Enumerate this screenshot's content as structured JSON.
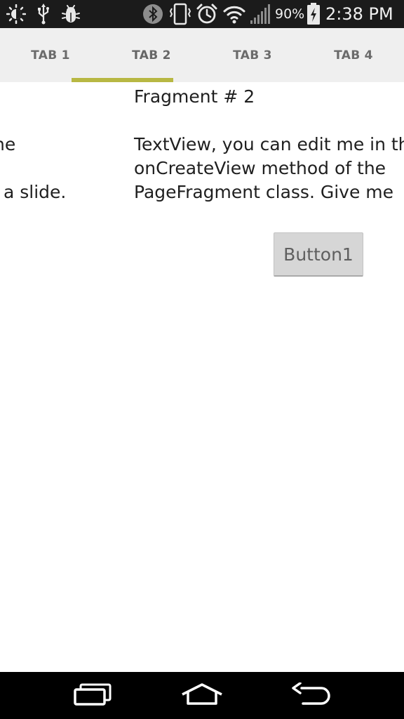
{
  "status_bar": {
    "battery_percent": "90%",
    "time": "2:38 PM",
    "icons": [
      "brightness-icon",
      "usb-icon",
      "debug-icon",
      "bluetooth-icon",
      "vibrate-icon",
      "alarm-icon",
      "wifi-icon",
      "signal-icon",
      "battery-charging-icon"
    ]
  },
  "tabs": [
    {
      "label": "TAB 1"
    },
    {
      "label": "TAB 2"
    },
    {
      "label": "TAB 3"
    },
    {
      "label": "TAB 4"
    }
  ],
  "selected_tab": "TAB 2",
  "accent_color": "#b8b843",
  "fragment_1": {
    "line1": "he",
    "line3": "a slide."
  },
  "fragment_2": {
    "title": "Fragment # 2",
    "line1": "TextView, you can edit me in th",
    "line2": "onCreateView method of the",
    "line3": "PageFragment class. Give me",
    "button_label": "Button1"
  },
  "nav_bar": {
    "icons": [
      "recent-apps-icon",
      "home-icon",
      "back-icon"
    ]
  }
}
